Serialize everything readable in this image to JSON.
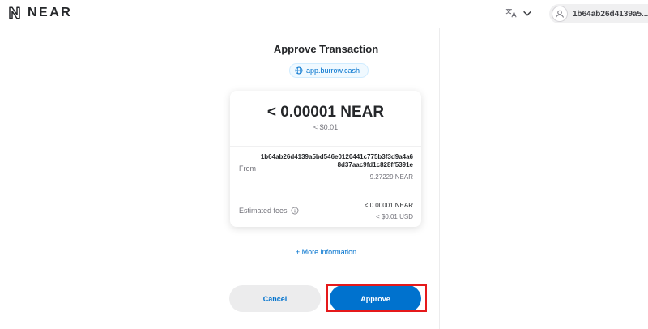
{
  "header": {
    "brand": "NEAR",
    "account_id": "1b64ab26d4139a5..."
  },
  "request": {
    "title": "Approve Transaction",
    "origin": "app.burrow.cash"
  },
  "transaction": {
    "amount": "< 0.00001 NEAR",
    "amount_usd": "< $0.01",
    "from_label": "From",
    "from_account": "1b64ab26d4139a5bd546e0120441c775b3f3d9a4a68d37aac9fd1c828ff5391e",
    "from_balance": "9.27229 NEAR",
    "fees_label": "Estimated fees",
    "fees_amount": "< 0.00001 NEAR",
    "fees_usd": "< $0.01 USD"
  },
  "more_info_label": "+ More information",
  "actions": {
    "cancel_label": "Cancel",
    "approve_label": "Approve"
  },
  "colors": {
    "accent": "#0072ce",
    "highlight": "#e5191b"
  }
}
